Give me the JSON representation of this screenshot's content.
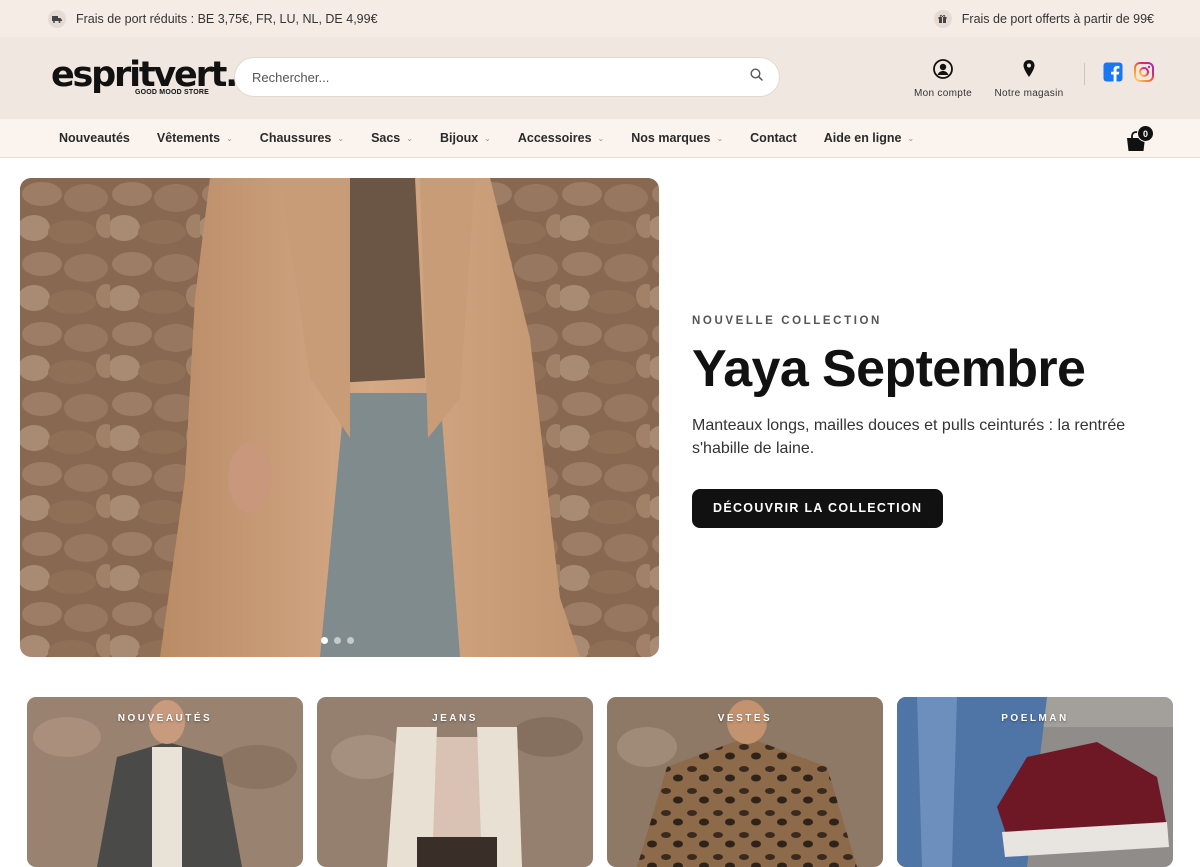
{
  "announcement": {
    "left_text": "Frais de port réduits : BE 3,75€, FR, LU, NL, DE 4,99€",
    "left_icon": "truck-icon",
    "right_text": "Frais de port offerts à partir de 99€",
    "right_icon": "gift-icon"
  },
  "header": {
    "logo_text": "espritvert.",
    "logo_tagline": "GOOD MOOD STORE",
    "search_placeholder": "Rechercher...",
    "account_label": "Mon compte",
    "store_label": "Notre magasin",
    "facebook_color": "#1877f2",
    "instagram_color": "#d62976"
  },
  "nav": {
    "items": [
      {
        "label": "Nouveautés",
        "has_menu": false
      },
      {
        "label": "Vêtements",
        "has_menu": true
      },
      {
        "label": "Chaussures",
        "has_menu": true
      },
      {
        "label": "Sacs",
        "has_menu": true
      },
      {
        "label": "Bijoux",
        "has_menu": true
      },
      {
        "label": "Accessoires",
        "has_menu": true
      },
      {
        "label": "Nos marques",
        "has_menu": true
      },
      {
        "label": "Contact",
        "has_menu": false
      },
      {
        "label": "Aide en ligne",
        "has_menu": true
      }
    ],
    "cart_count": "0"
  },
  "hero": {
    "eyebrow": "NOUVELLE COLLECTION",
    "title": "Yaya Septembre",
    "subtitle": "Manteaux longs, mailles douces et pulls ceinturés : la rentrée s'habille de laine.",
    "cta_label": "DÉCOUVRIR LA COLLECTION",
    "slide_count": 3,
    "active_slide": 1
  },
  "categories": [
    {
      "label": "NOUVEAUTÉS"
    },
    {
      "label": "JEANS"
    },
    {
      "label": "VESTES"
    },
    {
      "label": "POELMAN"
    }
  ],
  "colors": {
    "announcement_bg": "#f6ece6",
    "header_bg": "#f1e7e1",
    "nav_bg": "#fbf3ee",
    "cta_bg": "#111111"
  }
}
